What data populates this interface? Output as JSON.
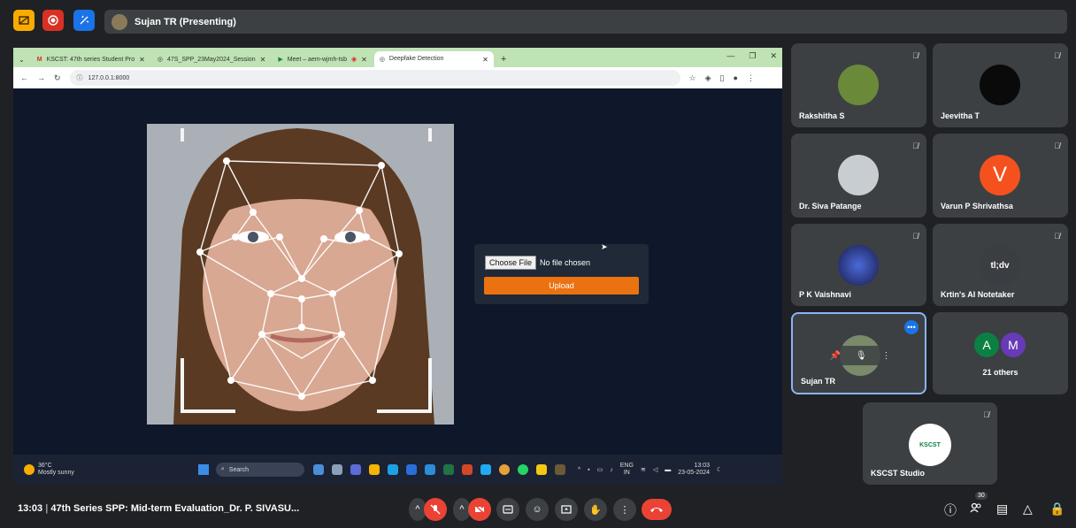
{
  "meet": {
    "presenting_label": "Sujan TR (Presenting)",
    "meeting_time": "13:03",
    "meeting_title": "47th Series SPP: Mid-term Evaluation_Dr. P. SIVASU...",
    "participant_count": "30"
  },
  "browser": {
    "tabs": [
      {
        "label": "KSCST: 47th series Student Pro"
      },
      {
        "label": "47S_SPP_23May2024_Session"
      },
      {
        "label": "Meet – aem-wjmh-tsb"
      },
      {
        "label": "Deepfake Detection"
      }
    ],
    "url": "127.0.0.1:8000"
  },
  "app": {
    "choose_file_label": "Choose File",
    "no_file_text": "No file chosen",
    "upload_label": "Upload"
  },
  "taskbar": {
    "weather_temp": "36°C",
    "weather_desc": "Mostly sunny",
    "search_label": "Search",
    "lang": "ENG",
    "region": "IN",
    "time": "13:03",
    "date": "23-05-2024"
  },
  "participants": [
    {
      "name": "Rakshitha S"
    },
    {
      "name": "Jeevitha T"
    },
    {
      "name": "Dr. Siva Patange"
    },
    {
      "name": "Varun P Shrivathsa",
      "initial": "V"
    },
    {
      "name": "P K Vaishnavi"
    },
    {
      "name": "Krtin's AI Notetaker",
      "logo_text": "tl;dv"
    },
    {
      "name": "Sujan TR"
    },
    {
      "name": "21 others",
      "initials": [
        "A",
        "M"
      ]
    },
    {
      "name": "KSCST Studio",
      "logo_text": "KSCST"
    }
  ],
  "colors": {
    "upload_button": "#ea7211",
    "end_call": "#ea4335",
    "varun_avatar": "#f4511e",
    "active_tile_border": "#8ab4f8"
  }
}
